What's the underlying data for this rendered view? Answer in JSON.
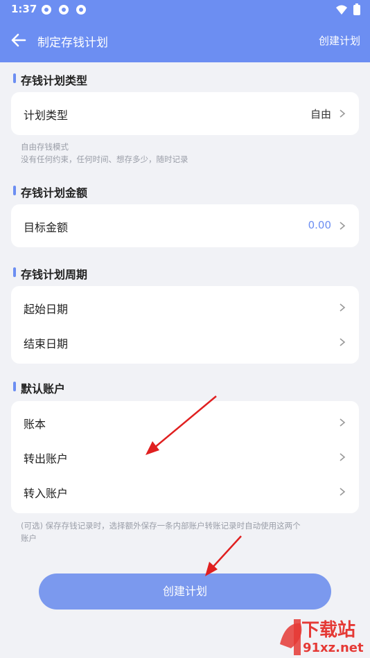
{
  "status_bar": {
    "time": "1:37"
  },
  "app_bar": {
    "title": "制定存钱计划",
    "action_label": "创建计划"
  },
  "sections": {
    "type": {
      "title": "存钱计划类型",
      "row_label": "计划类型",
      "row_value": "自由",
      "note_line1": "自由存钱模式",
      "note_line2": "没有任何约束，任何时间、想存多少，随时记录"
    },
    "amount": {
      "title": "存钱计划金额",
      "row_label": "目标金额",
      "row_value": "0.00"
    },
    "period": {
      "title": "存钱计划周期",
      "start_label": "起始日期",
      "end_label": "结束日期"
    },
    "account": {
      "title": "默认账户",
      "book_label": "账本",
      "out_label": "转出账户",
      "in_label": "转入账户",
      "note_line1": "(可选) 保存存钱记录时，选择额外保存一条内部账户转账记录时自动使用这两个",
      "note_line2": "账户"
    }
  },
  "create_button_label": "创建计划",
  "watermark": {
    "logo_text": "下载站",
    "url_text": "91xz.net"
  },
  "colors": {
    "accent": "#6c8ef2",
    "button": "#7b99ee",
    "annotation_arrow": "#e02020"
  }
}
